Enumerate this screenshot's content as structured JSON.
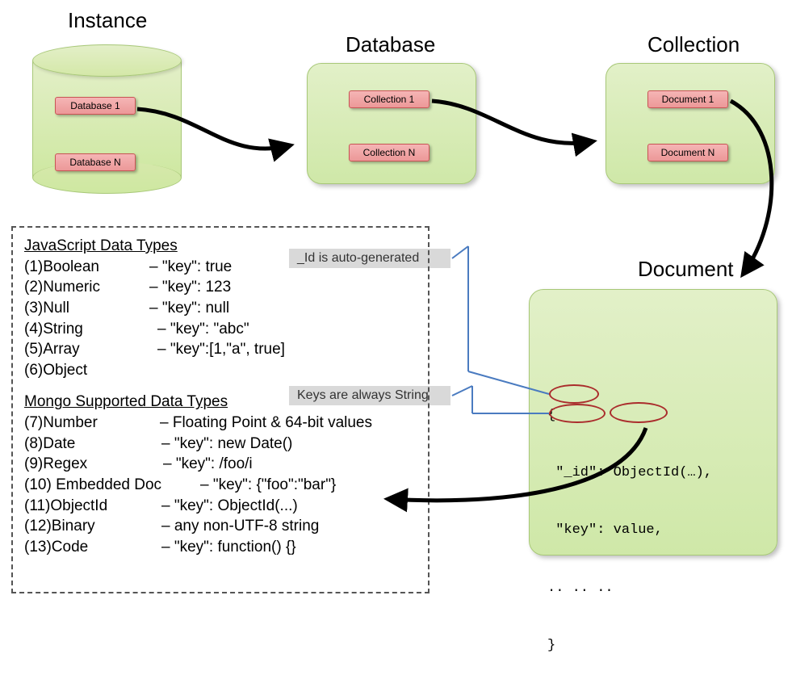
{
  "titles": {
    "instance": "Instance",
    "database": "Database",
    "collection": "Collection",
    "document": "Document"
  },
  "instance_items": {
    "db1": "Database 1",
    "dbn": "Database N"
  },
  "database_items": {
    "col1": "Collection 1",
    "coln": "Collection N"
  },
  "collection_items": {
    "doc1": "Document 1",
    "docn": "Document N"
  },
  "annotations": {
    "id_auto": "_Id is auto-generated",
    "keys_string": "Keys are always String"
  },
  "document_code": {
    "l1": "{",
    "l2": " \"_id\": ObjectId(…),",
    "l3": " \"key\": value,",
    "l4": ".. .. ..",
    "l5": "}"
  },
  "types": {
    "js_header": "JavaScript Data Types",
    "js_1": "(1)Boolean",
    "js_1v": "– \"key\": true",
    "js_2": "(2)Numeric",
    "js_2v": "– \"key\": 123",
    "js_3": "(3)Null",
    "js_3v": "– \"key\": null",
    "js_4": "(4)String",
    "js_4v": "– \"key\": \"abc\"",
    "js_5": "(5)Array",
    "js_5v": "– \"key\":[1,\"a\", true]",
    "js_6": "(6)Object",
    "mongo_header": "Mongo Supported Data Types",
    "m_7": "(7)Number",
    "m_7v": "– Floating Point & 64-bit values",
    "m_8": "(8)Date",
    "m_8v": "– \"key\": new Date()",
    "m_9": "(9)Regex",
    "m_9v": "– \"key\": /foo/i",
    "m_10": "(10) Embedded Doc",
    "m_10v": "– \"key\": {\"foo\":\"bar\"}",
    "m_11": "(11)ObjectId",
    "m_11v": "– \"key\": ObjectId(...)",
    "m_12": "(12)Binary",
    "m_12v": "– any non-UTF-8 string",
    "m_13": "(13)Code",
    "m_13v": "– \"key\": function() {}"
  }
}
